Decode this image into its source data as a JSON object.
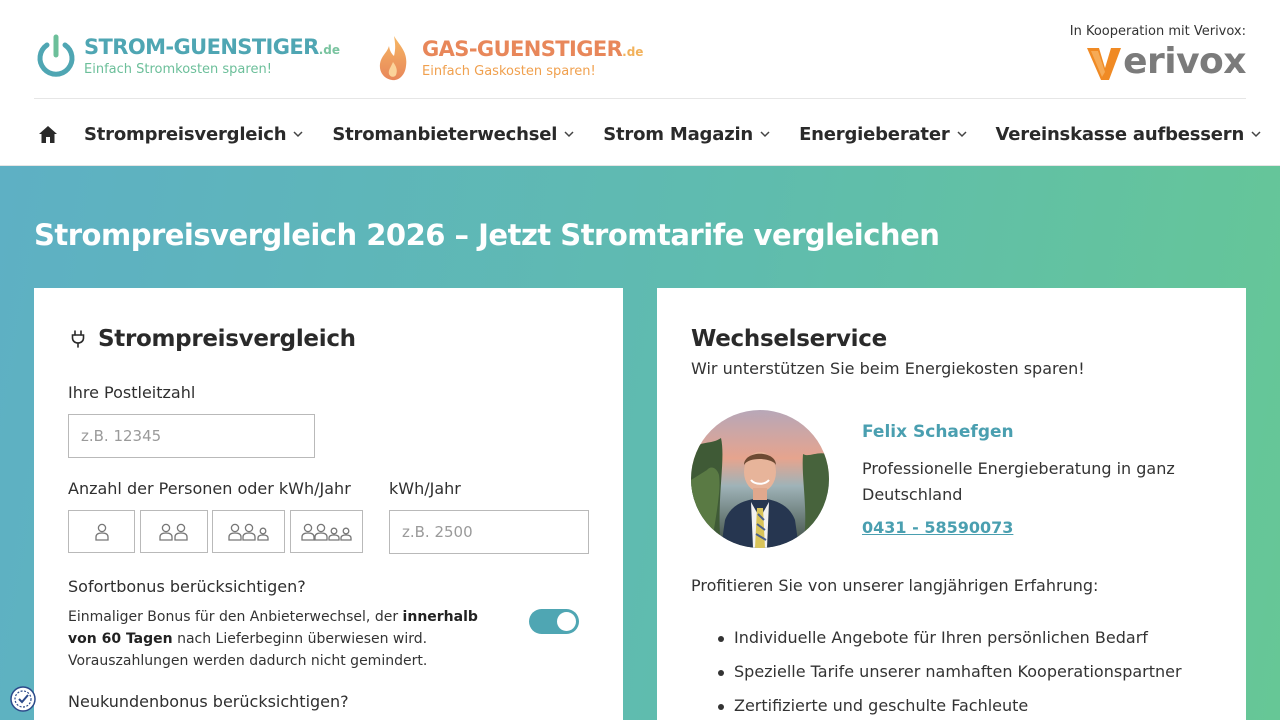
{
  "header": {
    "strom_logo": {
      "name": "STROM-GUENSTIGER",
      "tld": ".de",
      "tagline": "Einfach Stromkosten sparen!",
      "icon": "power-icon"
    },
    "gas_logo": {
      "name": "GAS-GUENSTIGER",
      "tld": ".de",
      "tagline": "Einfach Gaskosten sparen!",
      "icon": "flame-icon"
    },
    "partner": {
      "coop_text": "In Kooperation mit Verivox:",
      "brand": "erivox",
      "icon": "verivox-v-icon"
    }
  },
  "nav": {
    "home_icon": "home-icon",
    "items": [
      {
        "label": "Strompreisvergleich"
      },
      {
        "label": "Stromanbieterwechsel"
      },
      {
        "label": "Strom Magazin"
      },
      {
        "label": "Energieberater"
      },
      {
        "label": "Vereinskasse aufbessern"
      }
    ]
  },
  "hero": {
    "title": "Strompreisvergleich 2026 – Jetzt Stromtarife vergleichen"
  },
  "calculator": {
    "title": "Strompreisvergleich",
    "icon": "plug-icon",
    "zip_label": "Ihre Postleitzahl",
    "zip_placeholder": "z.B. 12345",
    "persons_label": "Anzahl der Personen oder kWh/Jahr",
    "persons_options": [
      1,
      2,
      3,
      4
    ],
    "kwh_label": "kWh/Jahr",
    "kwh_placeholder": "z.B. 2500",
    "bonus_question": "Sofortbonus berücksichtigen?",
    "bonus_text_pre": "Einmaliger Bonus für den Anbieterwechsel, der ",
    "bonus_text_bold": "innerhalb von 60 Tagen",
    "bonus_text_post": " nach Lieferbeginn überwiesen wird. Vorauszahlungen werden dadurch nicht gemindert.",
    "bonus_toggle_on": true,
    "new_customer_question": "Neukundenbonus berücksichtigen?"
  },
  "service": {
    "title": "Wechselservice",
    "subtitle": "Wir unterstützen Sie beim Energiekosten sparen!",
    "person_name": "Felix Schaefgen",
    "person_role": "Professionelle Energieberatung in ganz Deutschland",
    "phone": "0431 - 58590073",
    "profit_text": "Profitieren Sie von unserer langjährigen Erfahrung:",
    "benefits": [
      "Individuelle Angebote für Ihren persönlichen Bedarf",
      "Spezielle Tarife unserer namhaften Kooperationspartner",
      "Zertifizierte und geschulte Fachleute"
    ]
  },
  "colors": {
    "brand_teal": "#4fa6b3",
    "brand_green": "#6cbf9a",
    "gas_orange": "#e8875a",
    "hero_gradient_start": "#5eb0c4",
    "hero_gradient_end": "#66c796",
    "verivox_orange": "#f08a24",
    "verivox_grey": "#7b7b7b"
  }
}
